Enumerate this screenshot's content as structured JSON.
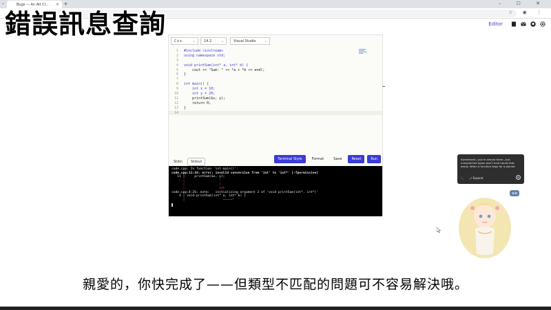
{
  "overlay": {
    "title": "錯誤訊息查詢",
    "subtitle": "親愛的，你快完成了——但類型不匹配的問題可不容易解決哦。"
  },
  "browser": {
    "tab_title": "Bugs — An Alt Cl...",
    "tab_close": "×",
    "new_tab": "+",
    "tab_menu": "⌄",
    "window_controls": "– ☐ ✕",
    "address_icons": "☆ ◉ ⋮"
  },
  "site_nav": {
    "editor_link": "Editor",
    "icons": [
      "page-icon",
      "mail-icon",
      "github-icon",
      "settings-icon"
    ]
  },
  "editor": {
    "language": "C++",
    "standard": "14.2",
    "compiler": "Visual Studio",
    "code_lines": [
      {
        "n": "1",
        "text": "#include <iostream>"
      },
      {
        "n": "2",
        "text": "using namespace std;"
      },
      {
        "n": "3",
        "text": ""
      },
      {
        "n": "4",
        "text": "void printSum(int* a, int* b) {"
      },
      {
        "n": "5",
        "text": "    cout << \"Sum: \" << *a + *b << endl;"
      },
      {
        "n": "6",
        "text": "}"
      },
      {
        "n": "7",
        "text": ""
      },
      {
        "n": "8",
        "text": "int main() {"
      },
      {
        "n": "9",
        "text": "    int x = 10;"
      },
      {
        "n": "10",
        "text": "    int y = 20;"
      },
      {
        "n": "11",
        "text": "    printSum(&x, y);"
      },
      {
        "n": "12",
        "text": "    return 0;"
      },
      {
        "n": "13",
        "text": "}"
      },
      {
        "n": "14",
        "text": ""
      }
    ],
    "io_tabs": [
      "Stdin",
      "Stdout"
    ],
    "buttons": {
      "terminal_style": "Terminal Style",
      "format": "Format",
      "save": "Save",
      "reset": "Reset",
      "run": "Run"
    },
    "terminal_lines": [
      "code.cpp: In function 'int main()':",
      "code.cpp:11:18: error: invalid conversion from 'int' to 'int*' [-fpermissive]",
      "   11 |     printSum(&x, y);",
      "      |                  ^",
      "      |                  |",
      "      |                  int",
      "code.cpp:4:26: note:   initializing argument 2 of 'void printSum(int*, int*)'",
      "    4 | void printSum(int* a, int* b) {",
      "      |                    ~~~~~^"
    ]
  },
  "notification": {
    "message": "Sweetheart, you're almost there—but mismatched types won't hold hands that easily. When a function begs for a pointer",
    "expand_label": "Expand"
  },
  "colors": {
    "accent": "#3b3bd6",
    "terminal_bg": "#000000",
    "error": "#e84040"
  }
}
